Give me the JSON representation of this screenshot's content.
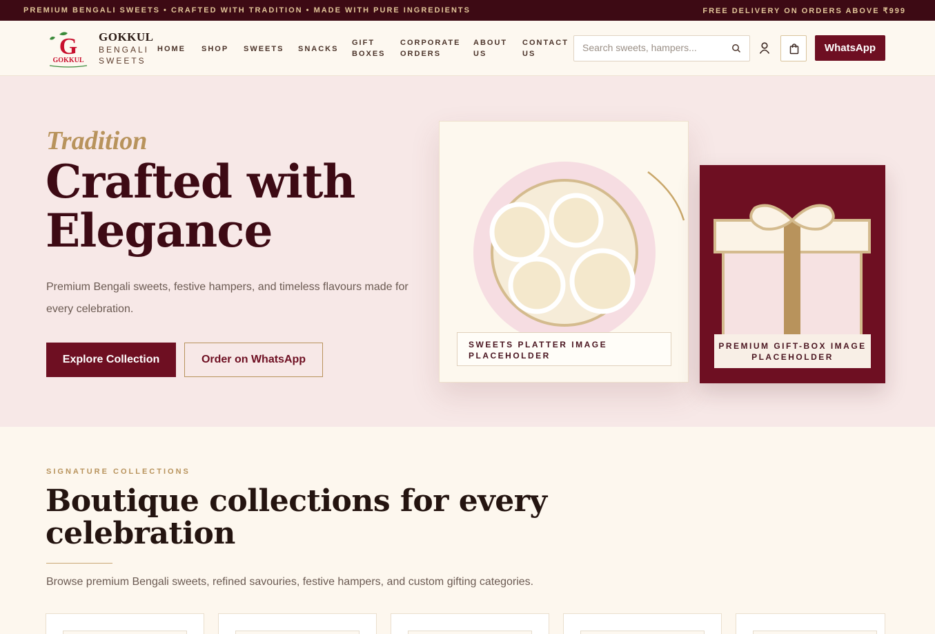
{
  "topbar": {
    "left_text": "PREMIUM BENGALI SWEETS • CRAFTED WITH TRADITION • MADE WITH PURE INGREDIENTS",
    "right_text": "FREE DELIVERY ON ORDERS ABOVE ₹999"
  },
  "brand": {
    "logo_letter": "G",
    "logo_text": "GOKKUL",
    "name": "GOKKUL",
    "subtitle": "BENGALI SWEETS"
  },
  "nav": {
    "home": "HOME",
    "shop": "SHOP",
    "sweets": "SWEETS",
    "snacks": "SNACKS",
    "gift_boxes": "GIFT BOXES",
    "corporate_orders": "CORPORATE ORDERS",
    "about_us": "ABOUT US",
    "contact_us": "CONTACT US"
  },
  "search": {
    "placeholder": "Search sweets, hampers...",
    "value": "",
    "icon": "search-icon"
  },
  "header_actions": {
    "account_icon": "user-icon",
    "cart_icon": "shopping-bag-icon",
    "whatsapp_label": "WhatsApp"
  },
  "hero": {
    "eyebrow": "Tradition",
    "title": "Crafted with Elegance",
    "description": "Premium Bengali sweets, festive hampers, and timeless flavours made for every celebration.",
    "primary_cta": "Explore Collection",
    "secondary_cta": "Order on WhatsApp",
    "platter_label": "SWEETS PLATTER IMAGE PLACEHOLDER",
    "gift_label": "PREMIUM GIFT-BOX IMAGE PLACEHOLDER"
  },
  "collections": {
    "eyebrow": "SIGNATURE COLLECTIONS",
    "title": "Boutique collections for every celebration",
    "description": "Browse premium Bengali sweets, refined savouries, festive hampers, and custom gifting categories."
  },
  "colors": {
    "maroon": "#6e0f22",
    "dark_maroon": "#3d0a14",
    "gold": "#b8935c",
    "cream": "#fdf7ee",
    "blush": "#f7e8e7"
  }
}
